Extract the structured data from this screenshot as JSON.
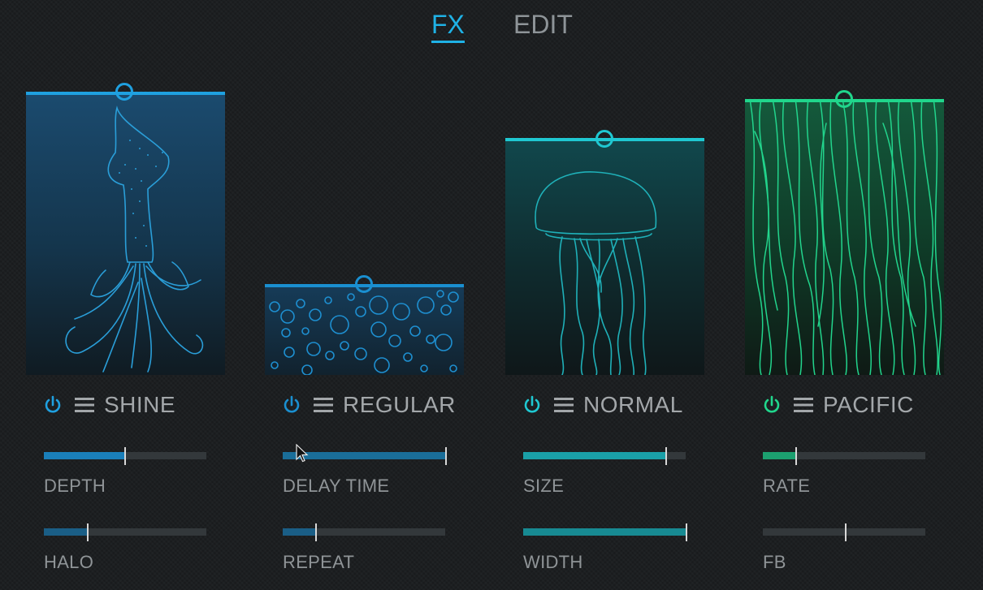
{
  "tabs": [
    {
      "label": "FX",
      "active": true
    },
    {
      "label": "EDIT",
      "active": false
    }
  ],
  "modules": [
    {
      "preset": "SHINE",
      "color": "#1fa0e0",
      "power_icon": "power-icon",
      "menu_icon": "menu-icon",
      "params": [
        {
          "label": "DEPTH",
          "value": 0.5
        },
        {
          "label": "HALO",
          "value": 0.27
        }
      ]
    },
    {
      "preset": "REGULAR",
      "color": "#1a8fd0",
      "power_icon": "power-icon",
      "menu_icon": "menu-icon",
      "params": [
        {
          "label": "DELAY TIME",
          "value": 1.0
        },
        {
          "label": "REPEAT",
          "value": 0.2
        }
      ]
    },
    {
      "preset": "NORMAL",
      "color": "#1fc8d2",
      "power_icon": "power-icon",
      "menu_icon": "menu-icon",
      "params": [
        {
          "label": "SIZE",
          "value": 0.88
        },
        {
          "label": "WIDTH",
          "value": 1.0
        }
      ]
    },
    {
      "preset": "PACIFIC",
      "color": "#20d68c",
      "power_icon": "power-icon",
      "menu_icon": "menu-icon",
      "params": [
        {
          "label": "RATE",
          "value": 0.2
        },
        {
          "label": "FB",
          "value": 0.5
        }
      ]
    }
  ],
  "colors": {
    "background": "#1c1f21",
    "tab_active": "#1fb2e6",
    "tab_inactive": "#8e9498",
    "text": "#a3a7aa",
    "slider_track": "#33383b",
    "slider_thumb": "#d8d8d8"
  }
}
